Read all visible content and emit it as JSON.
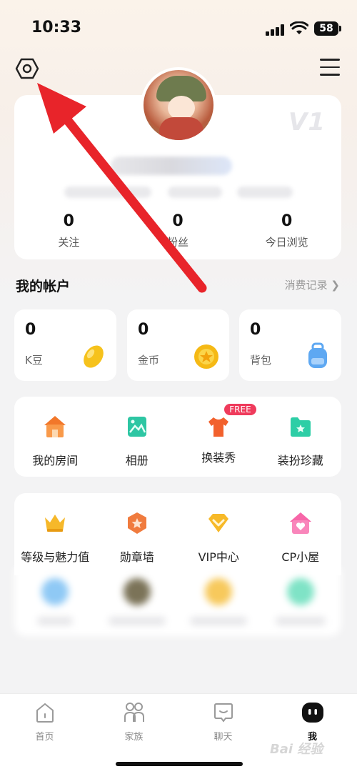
{
  "status_bar": {
    "time": "10:33",
    "battery": "58"
  },
  "profile": {
    "vip_level": "V1",
    "stats": [
      {
        "value": "0",
        "label": "关注"
      },
      {
        "value": "0",
        "label": "粉丝"
      },
      {
        "value": "0",
        "label": "今日浏览"
      }
    ]
  },
  "account": {
    "title": "我的帐户",
    "records_link": "消费记录",
    "cards": [
      {
        "value": "0",
        "label": "K豆"
      },
      {
        "value": "0",
        "label": "金币"
      },
      {
        "value": "0",
        "label": "背包"
      }
    ]
  },
  "features": {
    "row1": [
      {
        "label": "我的房间"
      },
      {
        "label": "相册"
      },
      {
        "label": "换装秀",
        "badge": "FREE"
      },
      {
        "label": "装扮珍藏"
      }
    ],
    "row2": [
      {
        "label": "等级与魅力值"
      },
      {
        "label": "勋章墙"
      },
      {
        "label": "VIP中心"
      },
      {
        "label": "CP小屋"
      }
    ]
  },
  "tabbar": {
    "tabs": [
      {
        "label": "首页",
        "icon": "home-icon"
      },
      {
        "label": "家族",
        "icon": "family-icon"
      },
      {
        "label": "聊天",
        "icon": "chat-icon"
      },
      {
        "label": "我",
        "icon": "me-icon"
      }
    ]
  },
  "watermark": "Bai 经验",
  "colors": {
    "accent_red": "#e8242a",
    "free_badge": "#ef3b5c",
    "background": "#f3f3f4"
  }
}
